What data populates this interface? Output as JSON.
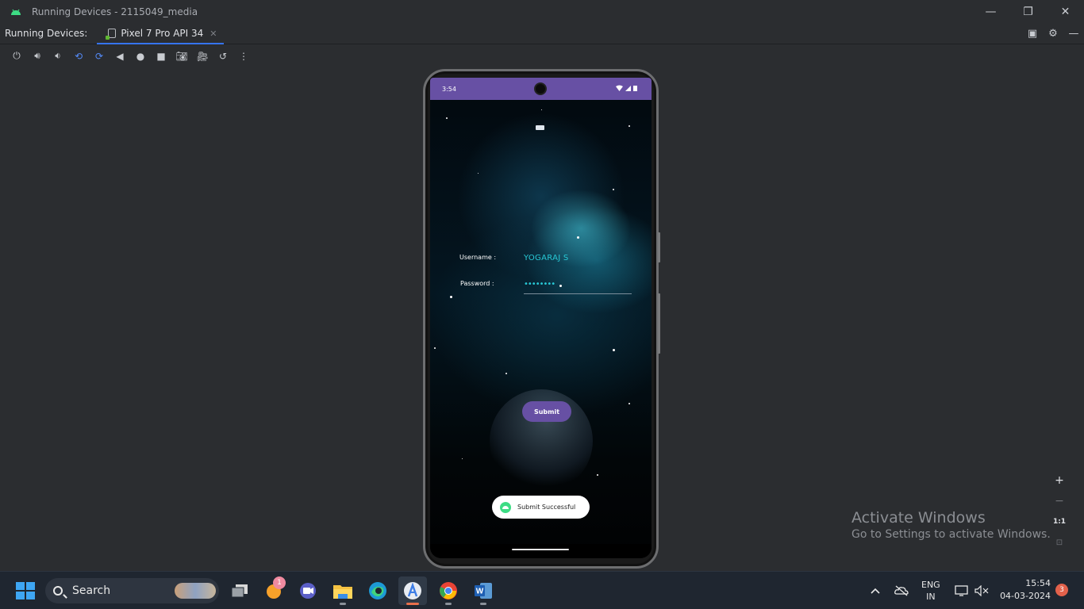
{
  "window": {
    "title": "Running Devices - 2115049_media",
    "minimize": "—",
    "restore": "❐",
    "close": "✕"
  },
  "tabbar": {
    "label": "Running Devices:",
    "tab_name": "Pixel 7 Pro API 34",
    "tab_close": "✕"
  },
  "device": {
    "status_time": "3:54",
    "username_label": "Username :",
    "username_value": "YOGARAJ S",
    "password_label": "Password :",
    "password_value": "••••••••",
    "submit_label": "Submit",
    "toast_text": "Submit Successful"
  },
  "zoom": {
    "zoom_in": "+",
    "zoom_out": "−",
    "actual_size": "1:1",
    "fit": "⊡"
  },
  "watermark": {
    "heading": "Activate Windows",
    "sub": "Go to Settings to activate Windows."
  },
  "taskbar": {
    "search_label": "Search",
    "mail_badge": "1",
    "lang_line1": "ENG",
    "lang_line2": "IN",
    "time": "15:54",
    "date": "04-03-2024",
    "notification_count": "3"
  }
}
